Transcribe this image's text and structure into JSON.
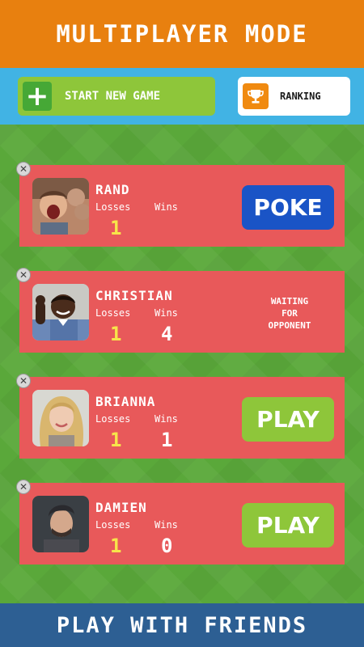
{
  "header": {
    "title": "MULTIPLAYER MODE"
  },
  "actions": {
    "start_label": "START NEW GAME",
    "ranking_label": "RANKING"
  },
  "stats_labels": {
    "losses": "Losses",
    "wins": "Wins"
  },
  "players": [
    {
      "name": "RAND",
      "losses": "1",
      "wins": "",
      "action": "POKE",
      "status": ""
    },
    {
      "name": "CHRISTIAN",
      "losses": "1",
      "wins": "4",
      "action": "",
      "status": "WAITING\nFOR\nOPPONENT"
    },
    {
      "name": "BRIANNA",
      "losses": "1",
      "wins": "1",
      "action": "PLAY",
      "status": ""
    },
    {
      "name": "DAMIEN",
      "losses": "1",
      "wins": "0",
      "action": "PLAY",
      "status": ""
    }
  ],
  "footer": {
    "title": "PLAY WITH FRIENDS"
  },
  "colors": {
    "header_bg": "#e8800f",
    "action_bar_bg": "#41b3e4",
    "card_bg": "#e8595a",
    "poke_button": "#1a54c6",
    "play_button": "#8ec63a",
    "footer_bg": "#2d5f93",
    "losses_value": "#f7e54a"
  },
  "icons": {
    "start": "plus-icon",
    "ranking": "trophy-icon",
    "remove": "close-icon"
  }
}
